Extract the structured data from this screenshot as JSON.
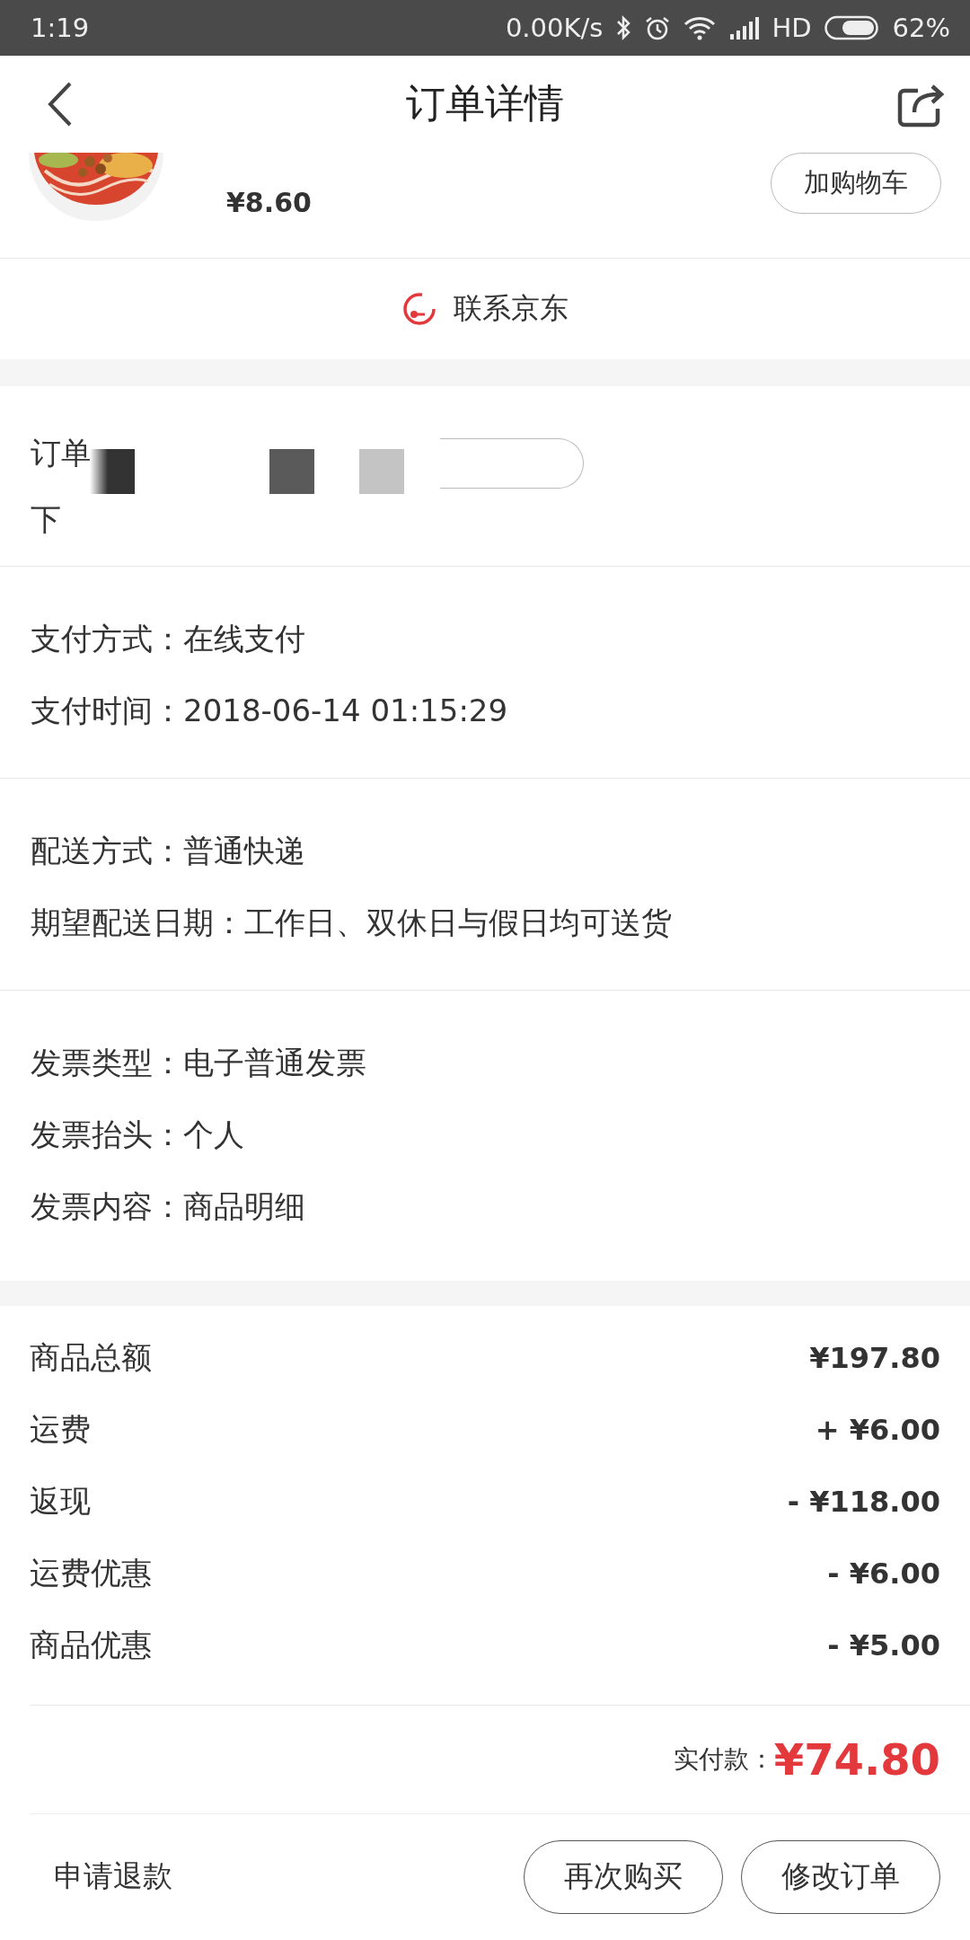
{
  "status_bar": {
    "time": "1:19",
    "network_speed": "0.00K/s",
    "network_type": "HD",
    "battery": "62%"
  },
  "header": {
    "title": "订单详情"
  },
  "product": {
    "price": "¥8.60",
    "button": "加购物车"
  },
  "contact": {
    "label": "联系京东"
  },
  "order_info": {
    "lines": [
      "订单",
      "下"
    ]
  },
  "info_sections": [
    {
      "lines": [
        "支付方式：在线支付",
        "支付时间：2018-06-14 01:15:29"
      ]
    },
    {
      "lines": [
        "配送方式：普通快递",
        "期望配送日期：工作日、双休日与假日均可送货"
      ]
    },
    {
      "lines": [
        "发票类型：电子普通发票",
        "发票抬头：个人",
        "发票内容：商品明细"
      ]
    }
  ],
  "amounts": [
    {
      "label": "商品总额",
      "value": "¥197.80"
    },
    {
      "label": "运费",
      "value": "+ ¥6.00"
    },
    {
      "label": "返现",
      "value": "- ¥118.00"
    },
    {
      "label": "运费优惠",
      "value": "- ¥6.00"
    },
    {
      "label": "商品优惠",
      "value": "- ¥5.00"
    }
  ],
  "total": {
    "label": "实付款：",
    "value": "¥74.80"
  },
  "actions": {
    "link": "申请退款",
    "buttons": [
      "再次购买",
      "修改订单"
    ]
  }
}
